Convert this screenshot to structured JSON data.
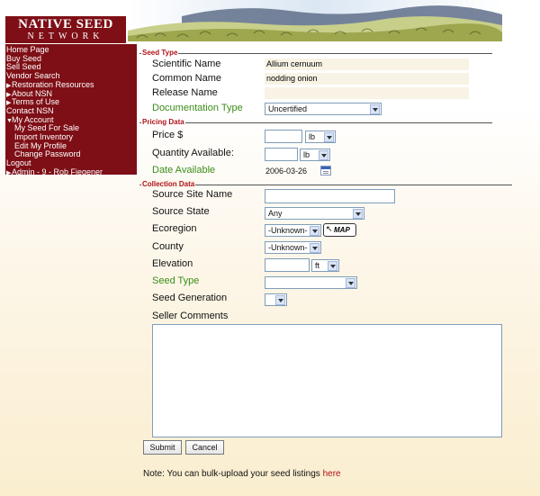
{
  "brand": {
    "line1": "NATIVE SEED",
    "line2": "NETWORK"
  },
  "sidebar": {
    "items": [
      {
        "label": "Home Page",
        "marker": ""
      },
      {
        "label": "Buy Seed",
        "marker": ""
      },
      {
        "label": "Sell Seed",
        "marker": ""
      },
      {
        "label": "Vendor Search",
        "marker": ""
      },
      {
        "label": "Restoration Resources",
        "marker": "▶"
      },
      {
        "label": "About NSN",
        "marker": "▶"
      },
      {
        "label": "Terms of Use",
        "marker": "▶"
      },
      {
        "label": "Contact NSN",
        "marker": ""
      },
      {
        "label": "My Account",
        "marker": "▼"
      },
      {
        "label": "My Seed For Sale",
        "marker": ""
      },
      {
        "label": "Import Inventory",
        "marker": ""
      },
      {
        "label": "Edit My Profile",
        "marker": ""
      },
      {
        "label": "Change Password",
        "marker": ""
      },
      {
        "label": "Logout",
        "marker": ""
      },
      {
        "label": "Admin - 9 - Rob Fiegener",
        "marker": "▶"
      }
    ]
  },
  "sections": {
    "seed_type": "Seed Type",
    "pricing": "Pricing Data",
    "collection": "Collection Data"
  },
  "seed": {
    "scientific_label": "Scientific Name",
    "scientific_value": "Allium cernuum",
    "common_label": "Common Name",
    "common_value": "nodding onion",
    "release_label": "Release Name",
    "release_value": "",
    "doctype_label": "Documentation Type",
    "doctype_value": "Uncertified"
  },
  "pricing": {
    "price_label": "Price $",
    "price_value": "",
    "price_unit": "lb",
    "qty_label": "Quantity Available:",
    "qty_value": "",
    "qty_unit": "lb",
    "date_label": "Date Available",
    "date_value": "2006-03-26"
  },
  "collection": {
    "site_label": "Source Site Name",
    "site_value": "",
    "state_label": "Source State",
    "state_value": "Any",
    "eco_label": "Ecoregion",
    "eco_value": "-Unknown-",
    "map_label": "MAP",
    "county_label": "County",
    "county_value": "-Unknown-",
    "elev_label": "Elevation",
    "elev_value": "",
    "elev_unit": "ft",
    "seedtype_label": "Seed Type",
    "seedtype_value": "",
    "gen_label": "Seed Generation",
    "gen_value": "",
    "comments_label": "Seller Comments",
    "comments_value": ""
  },
  "buttons": {
    "submit": "Submit",
    "cancel": "Cancel"
  },
  "note": {
    "text": "Note: You can bulk-upload your seed listings ",
    "link": "here"
  },
  "colors": {
    "brand": "#7e0f16",
    "legend": "#b0141b",
    "green_label": "#3b8d1a",
    "background": "#faeecf"
  }
}
